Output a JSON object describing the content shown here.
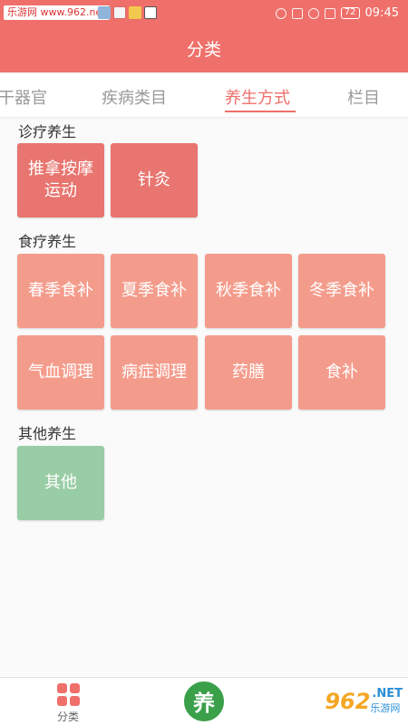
{
  "status_bar": {
    "watermark": "乐游网 www.962.net",
    "battery": "72",
    "time": "09:45"
  },
  "title": "分类",
  "tabs": [
    {
      "label": "干器官",
      "active": false
    },
    {
      "label": "疾病类目",
      "active": false
    },
    {
      "label": "养生方式",
      "active": true
    },
    {
      "label": "栏目",
      "active": false
    }
  ],
  "sections": {
    "diagnosis": {
      "title": "诊疗养生",
      "items": [
        "推拿按摩\n运动",
        "针灸"
      ]
    },
    "diet": {
      "title": "食疗养生",
      "items": [
        "春季食补",
        "夏季食补",
        "秋季食补",
        "冬季食补",
        "气血调理",
        "病症调理",
        "药膳",
        "食补"
      ]
    },
    "other": {
      "title": "其他养生",
      "items": [
        "其他"
      ]
    }
  },
  "bottom_nav": {
    "category_label": "分类",
    "center_badge": "养",
    "watermark_num": "962",
    "watermark_net": ".NET",
    "watermark_site": "乐游网"
  },
  "colors": {
    "accent": "#ef6f6a",
    "diagnosis_tile": "#e8756f",
    "diet_tile": "#f49c8c",
    "other_tile": "#99cda5",
    "badge_green": "#3aa04a"
  }
}
